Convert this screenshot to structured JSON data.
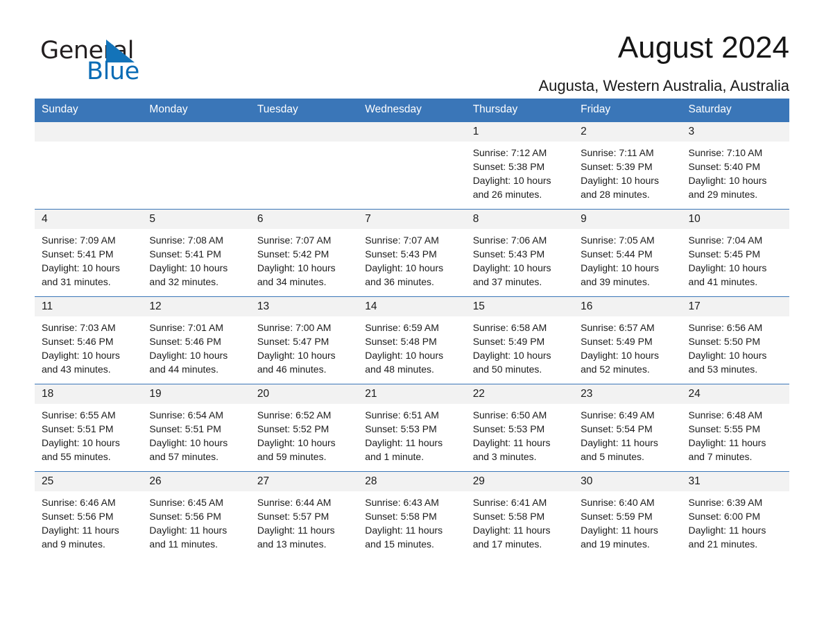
{
  "brand": {
    "name_part1": "General",
    "name_part2": "Blue",
    "accent_color": "#1373b9",
    "triangle_icon": "triangle-icon"
  },
  "header": {
    "month_title": "August 2024",
    "location": "Augusta, Western Australia, Australia"
  },
  "calendar": {
    "header_background": "#3a76b8",
    "daynum_background": "#f2f2f2",
    "weekday_headers": [
      "Sunday",
      "Monday",
      "Tuesday",
      "Wednesday",
      "Thursday",
      "Friday",
      "Saturday"
    ],
    "weeks": [
      [
        {
          "day": "",
          "lines": []
        },
        {
          "day": "",
          "lines": []
        },
        {
          "day": "",
          "lines": []
        },
        {
          "day": "",
          "lines": []
        },
        {
          "day": "1",
          "lines": [
            "Sunrise: 7:12 AM",
            "Sunset: 5:38 PM",
            "Daylight: 10 hours",
            "and 26 minutes."
          ]
        },
        {
          "day": "2",
          "lines": [
            "Sunrise: 7:11 AM",
            "Sunset: 5:39 PM",
            "Daylight: 10 hours",
            "and 28 minutes."
          ]
        },
        {
          "day": "3",
          "lines": [
            "Sunrise: 7:10 AM",
            "Sunset: 5:40 PM",
            "Daylight: 10 hours",
            "and 29 minutes."
          ]
        }
      ],
      [
        {
          "day": "4",
          "lines": [
            "Sunrise: 7:09 AM",
            "Sunset: 5:41 PM",
            "Daylight: 10 hours",
            "and 31 minutes."
          ]
        },
        {
          "day": "5",
          "lines": [
            "Sunrise: 7:08 AM",
            "Sunset: 5:41 PM",
            "Daylight: 10 hours",
            "and 32 minutes."
          ]
        },
        {
          "day": "6",
          "lines": [
            "Sunrise: 7:07 AM",
            "Sunset: 5:42 PM",
            "Daylight: 10 hours",
            "and 34 minutes."
          ]
        },
        {
          "day": "7",
          "lines": [
            "Sunrise: 7:07 AM",
            "Sunset: 5:43 PM",
            "Daylight: 10 hours",
            "and 36 minutes."
          ]
        },
        {
          "day": "8",
          "lines": [
            "Sunrise: 7:06 AM",
            "Sunset: 5:43 PM",
            "Daylight: 10 hours",
            "and 37 minutes."
          ]
        },
        {
          "day": "9",
          "lines": [
            "Sunrise: 7:05 AM",
            "Sunset: 5:44 PM",
            "Daylight: 10 hours",
            "and 39 minutes."
          ]
        },
        {
          "day": "10",
          "lines": [
            "Sunrise: 7:04 AM",
            "Sunset: 5:45 PM",
            "Daylight: 10 hours",
            "and 41 minutes."
          ]
        }
      ],
      [
        {
          "day": "11",
          "lines": [
            "Sunrise: 7:03 AM",
            "Sunset: 5:46 PM",
            "Daylight: 10 hours",
            "and 43 minutes."
          ]
        },
        {
          "day": "12",
          "lines": [
            "Sunrise: 7:01 AM",
            "Sunset: 5:46 PM",
            "Daylight: 10 hours",
            "and 44 minutes."
          ]
        },
        {
          "day": "13",
          "lines": [
            "Sunrise: 7:00 AM",
            "Sunset: 5:47 PM",
            "Daylight: 10 hours",
            "and 46 minutes."
          ]
        },
        {
          "day": "14",
          "lines": [
            "Sunrise: 6:59 AM",
            "Sunset: 5:48 PM",
            "Daylight: 10 hours",
            "and 48 minutes."
          ]
        },
        {
          "day": "15",
          "lines": [
            "Sunrise: 6:58 AM",
            "Sunset: 5:49 PM",
            "Daylight: 10 hours",
            "and 50 minutes."
          ]
        },
        {
          "day": "16",
          "lines": [
            "Sunrise: 6:57 AM",
            "Sunset: 5:49 PM",
            "Daylight: 10 hours",
            "and 52 minutes."
          ]
        },
        {
          "day": "17",
          "lines": [
            "Sunrise: 6:56 AM",
            "Sunset: 5:50 PM",
            "Daylight: 10 hours",
            "and 53 minutes."
          ]
        }
      ],
      [
        {
          "day": "18",
          "lines": [
            "Sunrise: 6:55 AM",
            "Sunset: 5:51 PM",
            "Daylight: 10 hours",
            "and 55 minutes."
          ]
        },
        {
          "day": "19",
          "lines": [
            "Sunrise: 6:54 AM",
            "Sunset: 5:51 PM",
            "Daylight: 10 hours",
            "and 57 minutes."
          ]
        },
        {
          "day": "20",
          "lines": [
            "Sunrise: 6:52 AM",
            "Sunset: 5:52 PM",
            "Daylight: 10 hours",
            "and 59 minutes."
          ]
        },
        {
          "day": "21",
          "lines": [
            "Sunrise: 6:51 AM",
            "Sunset: 5:53 PM",
            "Daylight: 11 hours",
            "and 1 minute."
          ]
        },
        {
          "day": "22",
          "lines": [
            "Sunrise: 6:50 AM",
            "Sunset: 5:53 PM",
            "Daylight: 11 hours",
            "and 3 minutes."
          ]
        },
        {
          "day": "23",
          "lines": [
            "Sunrise: 6:49 AM",
            "Sunset: 5:54 PM",
            "Daylight: 11 hours",
            "and 5 minutes."
          ]
        },
        {
          "day": "24",
          "lines": [
            "Sunrise: 6:48 AM",
            "Sunset: 5:55 PM",
            "Daylight: 11 hours",
            "and 7 minutes."
          ]
        }
      ],
      [
        {
          "day": "25",
          "lines": [
            "Sunrise: 6:46 AM",
            "Sunset: 5:56 PM",
            "Daylight: 11 hours",
            "and 9 minutes."
          ]
        },
        {
          "day": "26",
          "lines": [
            "Sunrise: 6:45 AM",
            "Sunset: 5:56 PM",
            "Daylight: 11 hours",
            "and 11 minutes."
          ]
        },
        {
          "day": "27",
          "lines": [
            "Sunrise: 6:44 AM",
            "Sunset: 5:57 PM",
            "Daylight: 11 hours",
            "and 13 minutes."
          ]
        },
        {
          "day": "28",
          "lines": [
            "Sunrise: 6:43 AM",
            "Sunset: 5:58 PM",
            "Daylight: 11 hours",
            "and 15 minutes."
          ]
        },
        {
          "day": "29",
          "lines": [
            "Sunrise: 6:41 AM",
            "Sunset: 5:58 PM",
            "Daylight: 11 hours",
            "and 17 minutes."
          ]
        },
        {
          "day": "30",
          "lines": [
            "Sunrise: 6:40 AM",
            "Sunset: 5:59 PM",
            "Daylight: 11 hours",
            "and 19 minutes."
          ]
        },
        {
          "day": "31",
          "lines": [
            "Sunrise: 6:39 AM",
            "Sunset: 6:00 PM",
            "Daylight: 11 hours",
            "and 21 minutes."
          ]
        }
      ]
    ]
  }
}
